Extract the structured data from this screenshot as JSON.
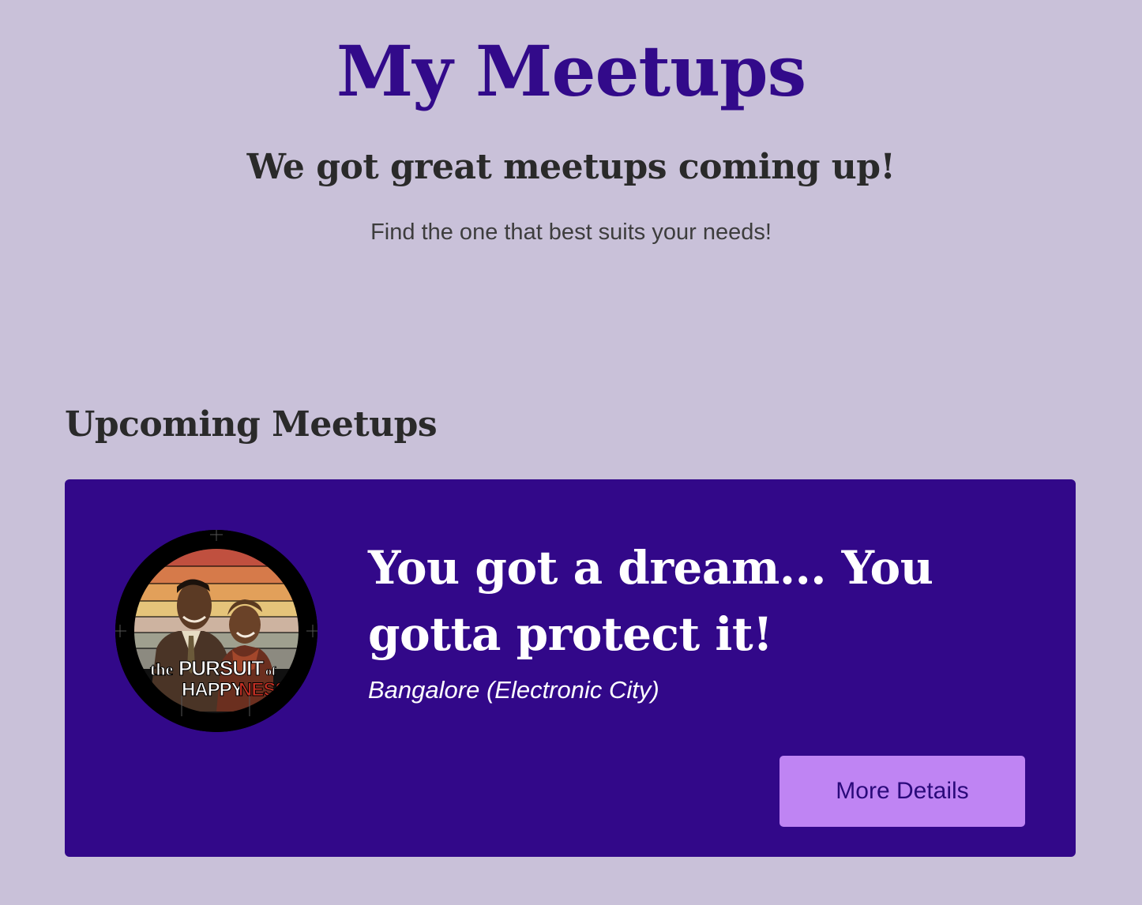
{
  "hero": {
    "title": "My Meetups",
    "subtitle": "We got great meetups coming up!",
    "tagline": "Find the one that best suits your needs!"
  },
  "upcoming": {
    "heading": "Upcoming Meetups",
    "meetups": [
      {
        "title": "You got a dream... You gotta protect it!",
        "location": "Bangalore (Electronic City)",
        "button_label": "More Details",
        "image_alt": "The Pursuit of Happyness poster",
        "image_text_line1_a": "the",
        "image_text_line1_b": "PURSUIT",
        "image_text_line1_c": "of",
        "image_text_line2_a": "HAPPY",
        "image_text_line2_b": "NESS"
      }
    ]
  },
  "colors": {
    "page_background": "#c9c1d9",
    "brand_purple": "#320a8a",
    "card_background": "#320889",
    "button_background": "#bf84f3",
    "button_text": "#2a0a7a"
  }
}
